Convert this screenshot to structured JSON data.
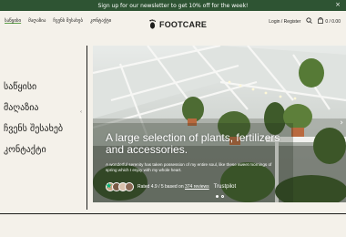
{
  "promo": {
    "text": "Sign up for our newsletter to get 10% off for the week!",
    "close": "×"
  },
  "header": {
    "nav": [
      "საწყისი",
      "მაღაზია",
      "ჩვენს შესახებ",
      "კონტაქტი"
    ],
    "logo": "FOOTCARE",
    "login": "Login / Register",
    "cart": "0 / 0.00"
  },
  "sidebar": {
    "items": [
      "საწყისი",
      "მაღაზია",
      "ჩვენს შესახებ",
      "კონტაქტი"
    ]
  },
  "hero": {
    "heading": "A large selection of plants, fertilizers and accessories.",
    "sub": "A wonderful serenity has taken possession of my entire soul, like these sweet mornings of spring which I enjoy with my whole heart.",
    "rating_prefix": "Rated 4.9 / 5 based on",
    "rating_link": "374 reviews",
    "trustpilot": "Trustpilot"
  },
  "colors": {
    "promo_bg": "#2e5433",
    "accent": "#5fa14a",
    "trustpilot": "#00b67a"
  },
  "icons": [
    "footprint-icon",
    "search-icon",
    "cart-icon",
    "close-icon",
    "star-icon",
    "chevron-right-icon"
  ]
}
